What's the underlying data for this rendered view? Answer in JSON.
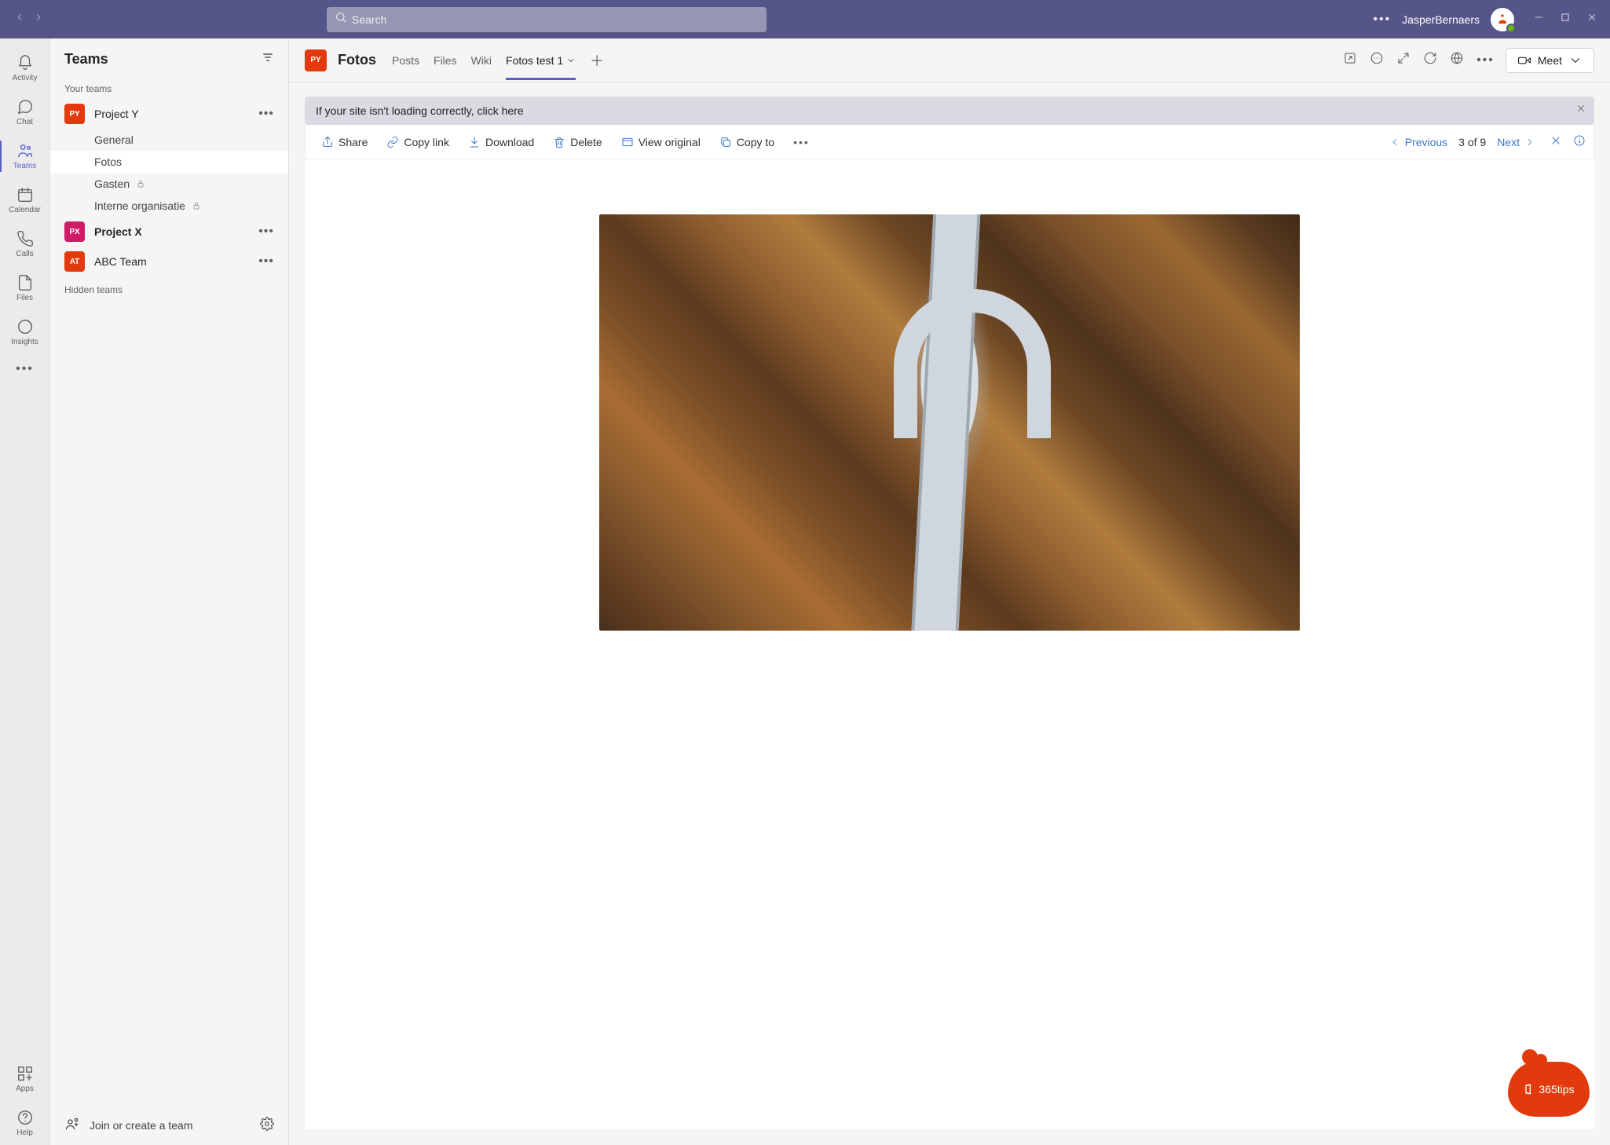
{
  "titlebar": {
    "search_placeholder": "Search",
    "username": "JasperBernaers"
  },
  "rail": {
    "items": [
      {
        "label": "Activity"
      },
      {
        "label": "Chat"
      },
      {
        "label": "Teams"
      },
      {
        "label": "Calendar"
      },
      {
        "label": "Calls"
      },
      {
        "label": "Files"
      },
      {
        "label": "Insights"
      }
    ],
    "apps_label": "Apps",
    "help_label": "Help"
  },
  "sidepanel": {
    "title": "Teams",
    "your_teams_label": "Your teams",
    "hidden_teams_label": "Hidden teams",
    "teams": [
      {
        "name": "Project Y",
        "initials": "PY",
        "color": "#e23a0d",
        "bold": false,
        "channels": [
          {
            "name": "General",
            "locked": false,
            "active": false
          },
          {
            "name": "Fotos",
            "locked": false,
            "active": true
          },
          {
            "name": "Gasten",
            "locked": true,
            "active": false
          },
          {
            "name": "Interne organisatie",
            "locked": true,
            "active": false
          }
        ]
      },
      {
        "name": "Project X",
        "initials": "PX",
        "color": "#d01b66",
        "bold": true,
        "channels": []
      },
      {
        "name": "ABC Team",
        "initials": "AT",
        "color": "#e23a0d",
        "bold": false,
        "channels": []
      }
    ],
    "join_label": "Join or create a team"
  },
  "content": {
    "team_initials": "PY",
    "channel_name": "Fotos",
    "tabs": [
      {
        "label": "Posts",
        "active": false
      },
      {
        "label": "Files",
        "active": false
      },
      {
        "label": "Wiki",
        "active": false
      },
      {
        "label": "Fotos test 1",
        "active": true,
        "dropdown": true
      }
    ],
    "meet_label": "Meet",
    "banner_text": "If your site isn't loading correctly, click here",
    "toolbar": {
      "share": "Share",
      "copy_link": "Copy link",
      "download": "Download",
      "delete": "Delete",
      "view_original": "View original",
      "copy_to": "Copy to",
      "previous": "Previous",
      "counter": "3 of 9",
      "next": "Next"
    }
  },
  "badge": {
    "text": "365tips"
  }
}
